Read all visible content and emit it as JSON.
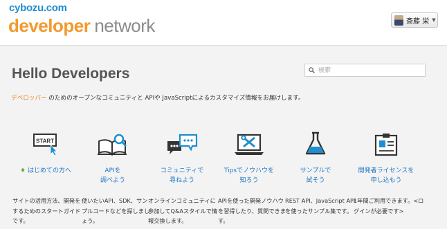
{
  "header": {
    "logo_top": "cybozu.com",
    "logo_main": "developer",
    "logo_sub": "network",
    "user_name": "斎藤 栄",
    "user_caret": "▼"
  },
  "page": {
    "title": "Hello Developers",
    "search_placeholder": "検索",
    "intro_link": "デベロッパー",
    "intro_rest": " のためのオープンなコミュニティと APIや JavaScriptによるカスタマイズ情報をお届けします。"
  },
  "features": [
    {
      "icon": "start-icon",
      "line1": "はじめての方へ",
      "line2": "",
      "leaf": "♦",
      "desc": "サイトの活用方法、開発をするためのスタートガイドです。"
    },
    {
      "icon": "book-search-icon",
      "line1": "APIを",
      "line2": "調べよう",
      "desc": "使いたいAPI、SDK、サンプルコードなどを探しましょう。"
    },
    {
      "icon": "chat-icon",
      "line1": "コミュニティで",
      "line2": "尋ねよう",
      "desc": "オンラインコミュニティに参加してQ&Aスタイルで情報交換します。"
    },
    {
      "icon": "tools-laptop-icon",
      "line1": "Tipsでノウハウを",
      "line2": "知ろう",
      "desc": "APIを使った開発ノウハウを習得したり、質問できます。"
    },
    {
      "icon": "flask-icon",
      "line1": "サンプルで",
      "line2": "試そう",
      "desc": "REST API、JavaScript API を使ったサンプル集です。"
    },
    {
      "icon": "id-card-icon",
      "line1": "開発者ライセンスを",
      "line2": "申し込もう",
      "desc": "1年間ご利用できます。<ログインが必要です>"
    }
  ]
}
